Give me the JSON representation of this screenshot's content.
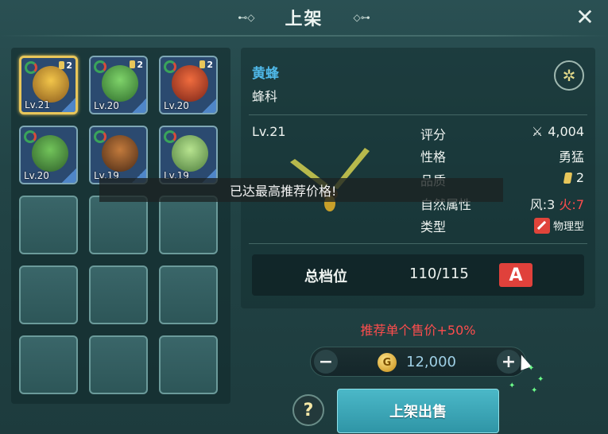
{
  "title": "上架",
  "inventory": {
    "slots": [
      {
        "level": "Lv.21",
        "quality": "2",
        "selected": true
      },
      {
        "level": "Lv.20",
        "quality": "2",
        "selected": false
      },
      {
        "level": "Lv.20",
        "quality": "2",
        "selected": false
      },
      {
        "level": "Lv.20",
        "quality": "",
        "selected": false
      },
      {
        "level": "Lv.19",
        "quality": "",
        "selected": false
      },
      {
        "level": "Lv.19",
        "quality": "",
        "selected": false
      }
    ],
    "empty_slots": 9
  },
  "detail": {
    "name": "黄蜂",
    "family": "蜂科",
    "level": "Lv.21",
    "stats": {
      "score_label": "评分",
      "score_value": "4,004",
      "nature_label": "性格",
      "nature_value": "勇猛",
      "quality_label": "品质",
      "quality_value": "2",
      "element_label": "自然属性",
      "element_value_wind": "风:3",
      "element_value_fire": "火:7",
      "type_label": "类型",
      "type_value": "物理型"
    },
    "tier_label": "总档位",
    "tier_value": "110/115",
    "tier_grade": "A"
  },
  "toast": "已达最高推荐价格!",
  "recommend_text": "推荐单个售价+50%",
  "price": {
    "minus": "−",
    "plus": "+",
    "coin_symbol": "G",
    "value": "12,000"
  },
  "help_label": "?",
  "sell_button": "上架出售",
  "close_icon": "✕"
}
